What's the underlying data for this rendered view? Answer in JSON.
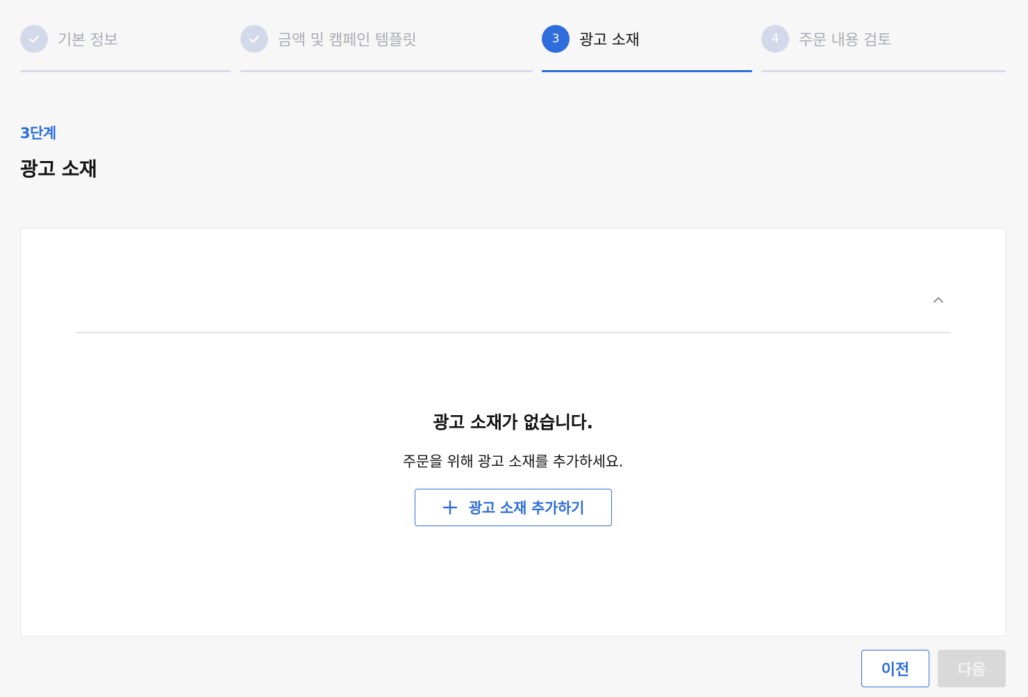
{
  "stepper": {
    "steps": [
      {
        "label": "기본 정보",
        "state": "done",
        "icon": "check-icon"
      },
      {
        "label": "금액 및 캠페인 템플릿",
        "state": "done",
        "icon": "check-icon"
      },
      {
        "number": "3",
        "label": "광고 소재",
        "state": "active"
      },
      {
        "number": "4",
        "label": "주문 내용 검토",
        "state": "todo"
      }
    ]
  },
  "section": {
    "step_index": "3단계",
    "title": "광고 소재"
  },
  "panel": {
    "collapse_icon": "chevron-up-icon",
    "empty_title": "광고 소재가 없습니다.",
    "empty_description": "주문을 위해 광고 소재를 추가하세요.",
    "add_button_label": "광고 소재 추가하기",
    "add_button_icon": "plus-icon"
  },
  "footer": {
    "prev_label": "이전",
    "next_label": "다음",
    "next_disabled": true
  },
  "colors": {
    "accent": "#2e6ddb",
    "inactive_circle": "#d3d9ea",
    "inactive_text": "#a9adb6",
    "disabled_button": "#d9d9d9",
    "page_background": "#f7f7f7"
  }
}
